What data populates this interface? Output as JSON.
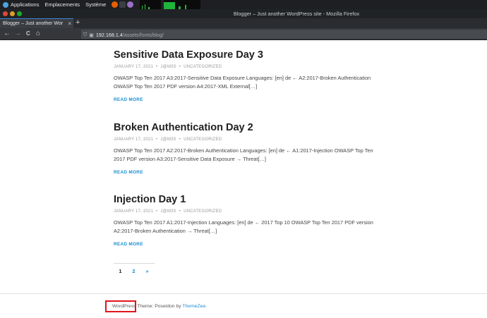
{
  "system_panel": {
    "menus": [
      "Applications",
      "Emplacements",
      "Système"
    ]
  },
  "window": {
    "title": "Blogger – Just another WordPress site - Mozilla Firefox"
  },
  "tab": {
    "label": "Blogger – Just another Wor",
    "close": "×",
    "new_tab": "+"
  },
  "navbar": {
    "back": "←",
    "forward": "→",
    "reload": "C",
    "home": "⌂",
    "url_host": "192.168.1.4",
    "url_path": "/assets/fonts/blog/"
  },
  "posts": [
    {
      "title": "Sensitive Data Exposure Day 3",
      "date": "JANUARY 17, 2021",
      "author": "J@M3S",
      "category": "UNCATEGORIZED",
      "excerpt": "OWASP Top Ten 2017 A3:2017-Sensitive Data Exposure Languages: [en] de ← A2:2017-Broken Authentication OWASP Top Ten 2017 PDF version A4:2017-XML External[…]",
      "read_more": "READ MORE"
    },
    {
      "title": "Broken Authentication Day 2",
      "date": "JANUARY 17, 2021",
      "author": "J@M3S",
      "category": "UNCATEGORIZED",
      "excerpt": "OWASP Top Ten 2017 A2:2017-Broken Authentication Languages: [en] de ← A1:2017-Injection OWASP Top Ten 2017 PDF version A3:2017-Sensitive Data Exposure → Threat[…]",
      "read_more": "READ MORE"
    },
    {
      "title": "Injection Day 1",
      "date": "JANUARY 17, 2021",
      "author": "J@M3S",
      "category": "UNCATEGORIZED",
      "excerpt": "OWASP Top Ten 2017 A1:2017-Injection Languages: [en] de ← 2017 Top 10 OWASP Top Ten 2017 PDF version  A2:2017-Broken Authentication → Threat[…]",
      "read_more": "READ MORE"
    }
  ],
  "pagination": {
    "current": "1",
    "next_page": "2",
    "next": "»"
  },
  "footer": {
    "wordpress": "WordPress",
    "theme_text": " Theme: Poseidon by ",
    "themezee": "ThemeZee",
    "end": "."
  },
  "colors": {
    "link": "#1b8fd1",
    "highlight": "#e0161e"
  }
}
